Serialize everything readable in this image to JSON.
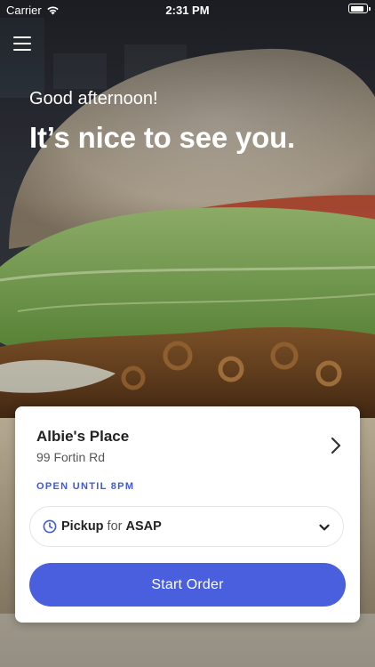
{
  "status_bar": {
    "carrier": "Carrier",
    "time": "2:31 PM",
    "battery_level": 0.9
  },
  "greeting": {
    "subtitle": "Good afternoon!",
    "headline": "It’s nice to see you."
  },
  "location_card": {
    "name": "Albie's Place",
    "address": "99 Fortin Rd",
    "status": "OPEN UNTIL 8PM",
    "pickup": {
      "method": "Pickup",
      "joiner": "for",
      "time": "ASAP"
    },
    "start_button_label": "Start Order"
  },
  "icons": {
    "menu": "hamburger-menu-icon",
    "wifi": "wifi-icon",
    "battery": "battery-icon",
    "chevron": "chevron-right-icon",
    "clock": "clock-icon",
    "dropdown": "chevron-down-icon"
  },
  "colors": {
    "accent": "#4a5fde",
    "status_text": "#3f5bd6",
    "card_bg": "#ffffff"
  }
}
